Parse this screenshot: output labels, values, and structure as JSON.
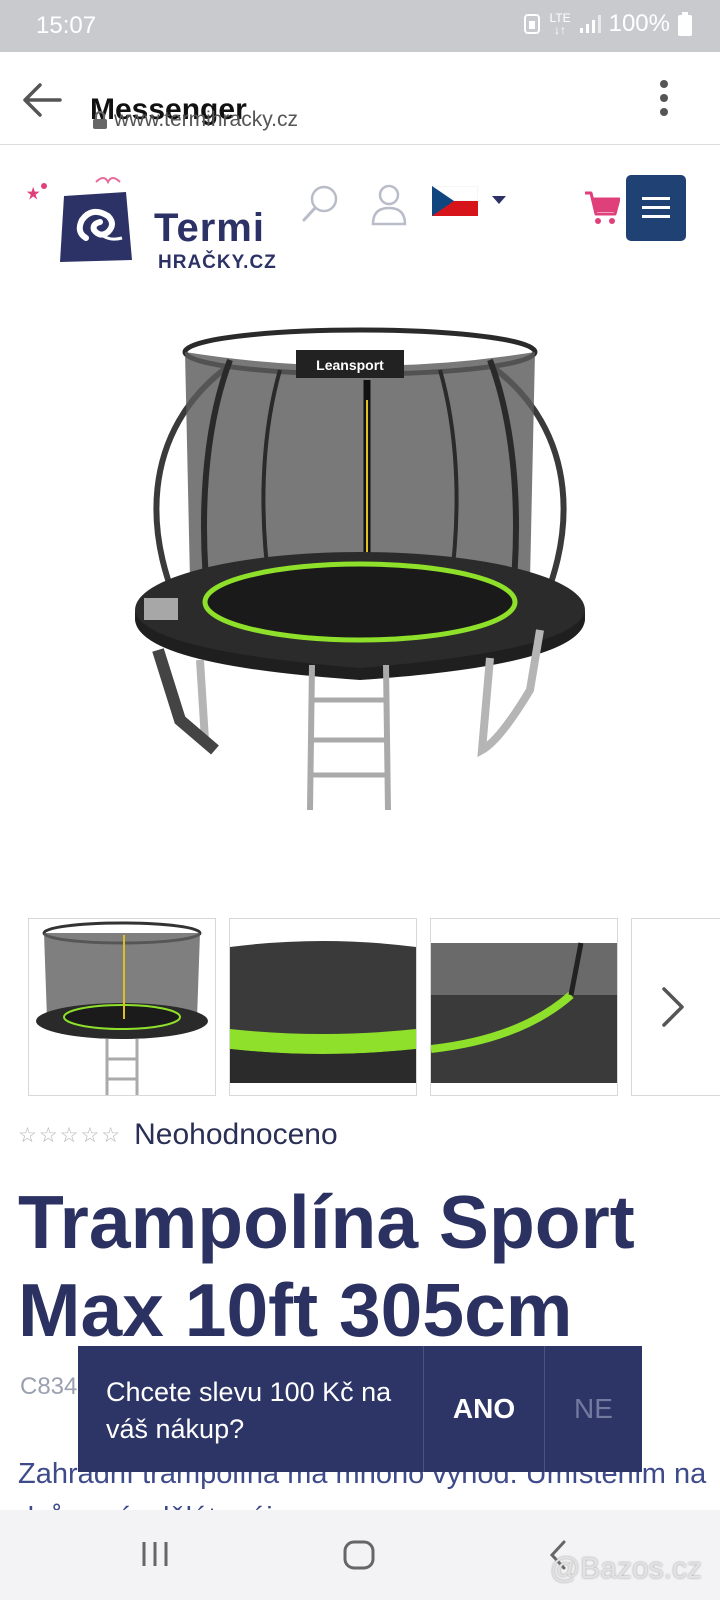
{
  "status_bar": {
    "time": "15:07",
    "network": "LTE",
    "battery": "100%"
  },
  "browser": {
    "title": "Messenger",
    "url": "www.termihracky.cz"
  },
  "site": {
    "logo_top": "Termi",
    "logo_bottom": "HRAČKY.CZ"
  },
  "product": {
    "rating_text": "Neohodnoceno",
    "title": "Trampolína Sport Max 10ft 305cm",
    "code": "C834",
    "description": "Zahradní trampolína má mnoho výhod. Umístěním na dvůr z ní uděláte ráj pro"
  },
  "image": {
    "brand_label": "Leansport"
  },
  "popup": {
    "question": "Chcete slevu 100 Kč na váš nákup?",
    "yes": "ANO",
    "no": "NE"
  },
  "watermark": "Bazos.cz",
  "colors": {
    "brand_navy": "#2c3266",
    "menu_button": "#1f4173",
    "cart": "#e0407a",
    "net_green": "#8ee02a"
  }
}
